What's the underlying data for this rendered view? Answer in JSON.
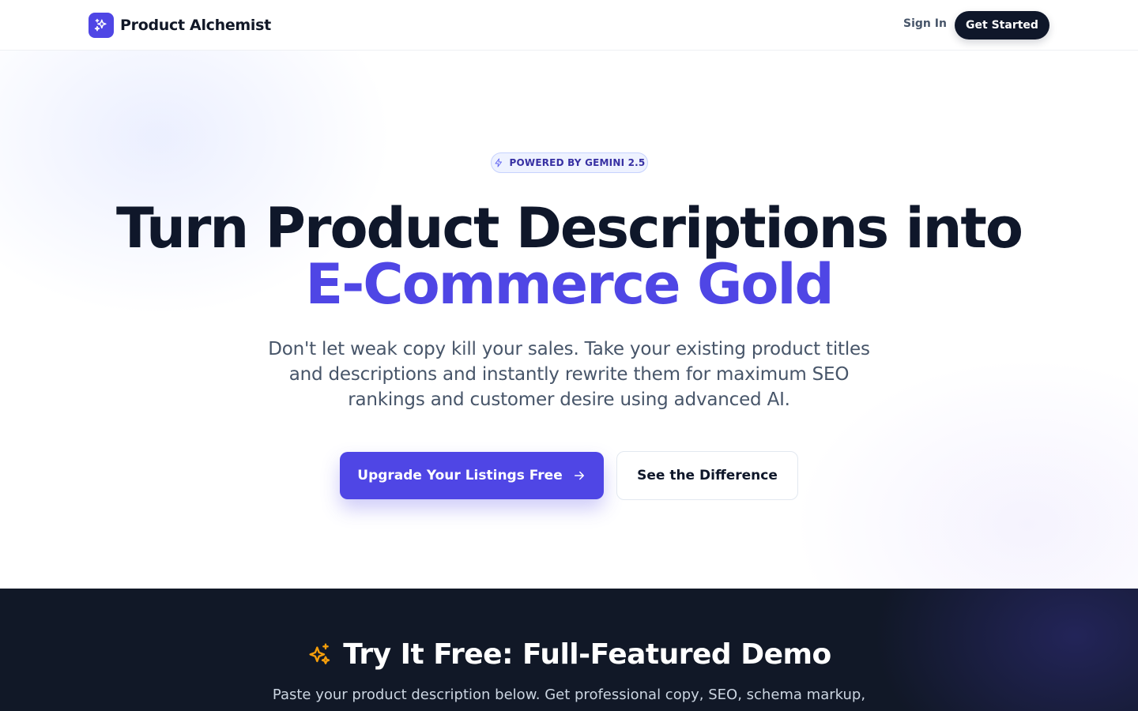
{
  "nav": {
    "brand_name": "Product Alchemist",
    "brand_icon": "sparkles-icon",
    "signin_label": "Sign In",
    "getstarted_label": "Get Started"
  },
  "hero": {
    "badge_icon": "zap-icon",
    "badge_text": "POWERED BY GEMINI 2.5",
    "headline_line1": "Turn Product Descriptions into",
    "headline_line2": "E-Commerce Gold",
    "subheadline": "Don't let weak copy kill your sales. Take your existing product titles and descriptions and instantly rewrite them for maximum SEO rankings and customer desire using advanced AI.",
    "cta_primary_label": "Upgrade Your Listings Free",
    "cta_primary_icon": "arrow-right-icon",
    "cta_secondary_label": "See the Difference"
  },
  "demo": {
    "title_icon": "sparkles-icon",
    "title": "Try It Free: Full-Featured Demo",
    "subtitle": "Paste your product description below. Get professional copy, SEO, schema markup,"
  },
  "colors": {
    "accent": "#4f46e5",
    "dark": "#0f172a",
    "demo_bg": "#111827",
    "demo_icon": "#f59e0b"
  }
}
